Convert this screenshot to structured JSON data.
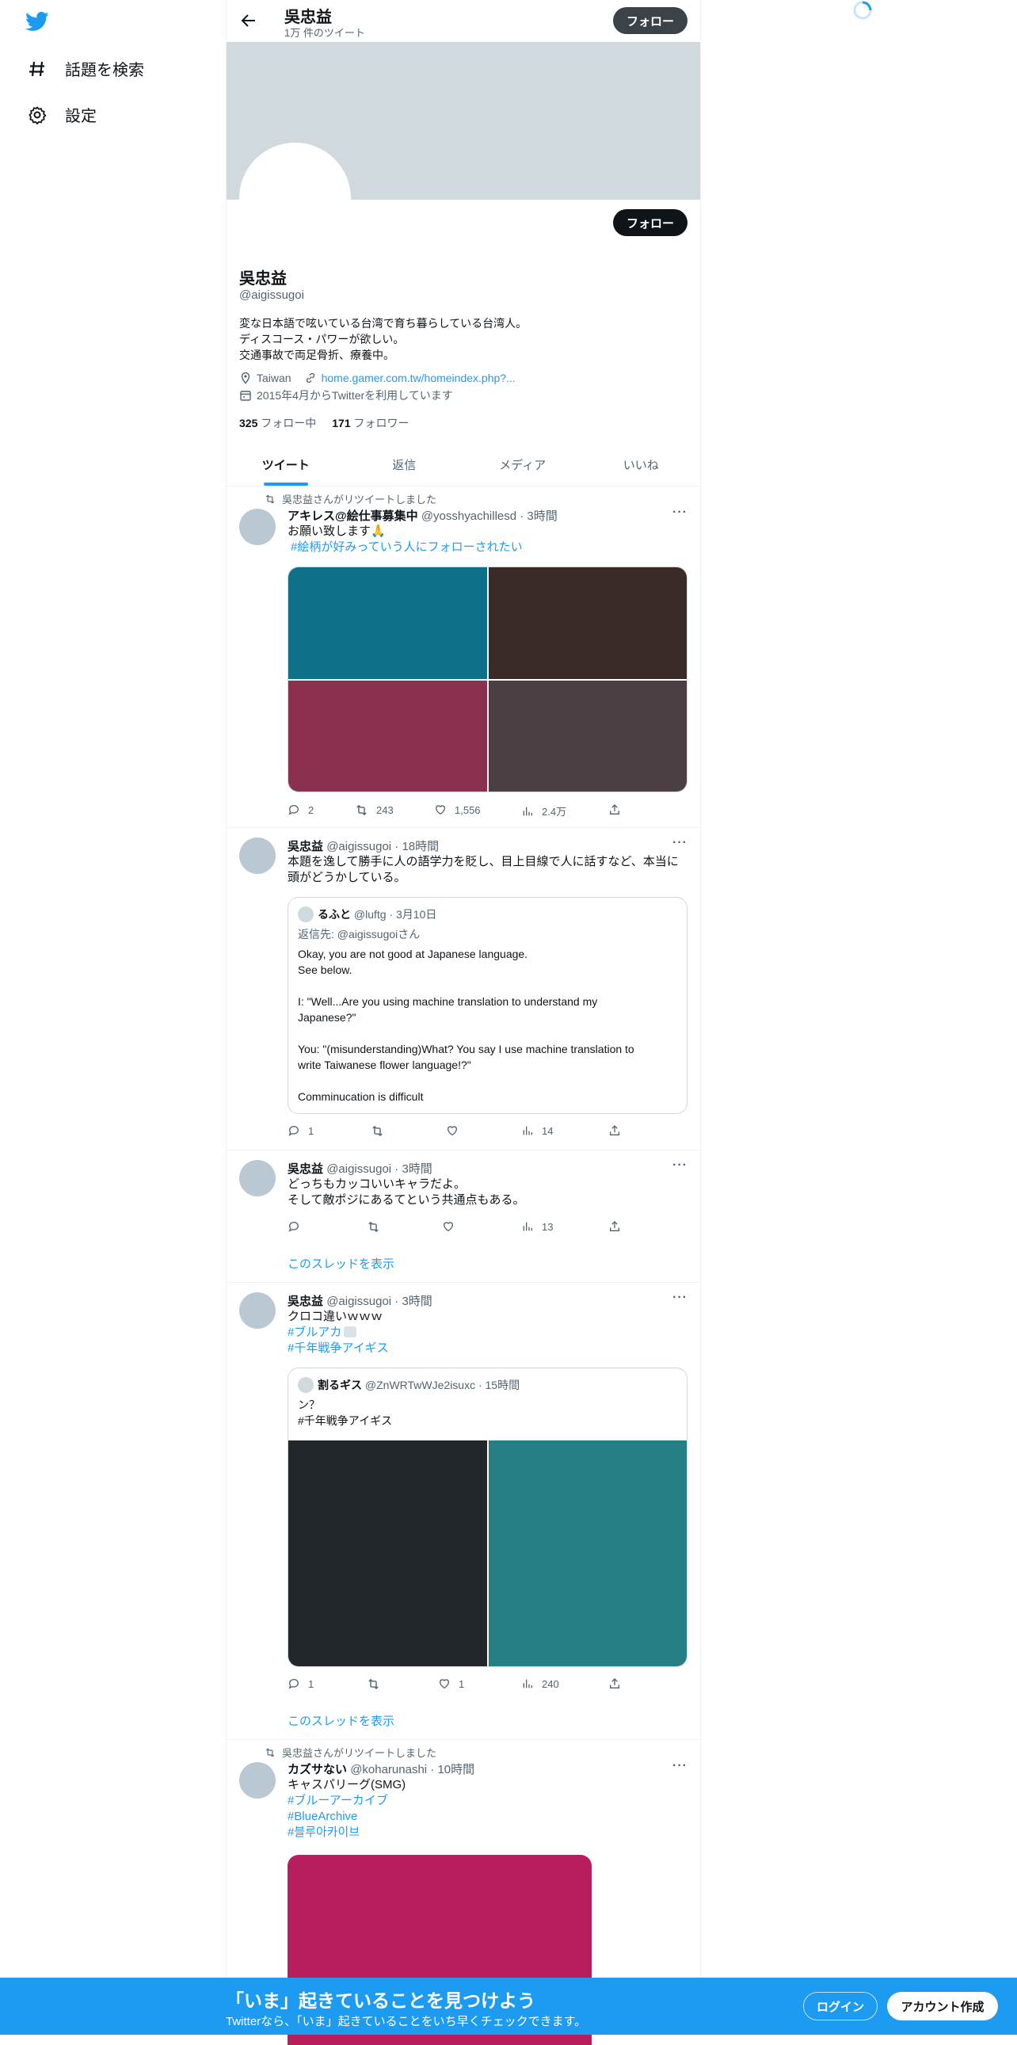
{
  "nav": {
    "items": [
      {
        "label": "話題を検索",
        "icon": "hashtag-icon"
      },
      {
        "label": "設定",
        "icon": "gear-icon"
      }
    ]
  },
  "topbar": {
    "name": "吳忠益",
    "tweet_count": "1万 件のツイート",
    "follow_label": "フォロー"
  },
  "profile": {
    "follow_label": "フォロー",
    "name": "吳忠益",
    "handle": "@aigissugoi",
    "bio": [
      "変な日本語で呟いている台湾で育ち暮らしている台湾人。",
      "ディスコース・パワーが欲しい。",
      "交通事故で両足骨折、療養中。"
    ],
    "location": "Taiwan",
    "url": "home.gamer.com.tw/homeindex.php?...",
    "joined": "2015年4月からTwitterを利用しています",
    "following_count": "325",
    "following_label": "フォロー中",
    "followers_count": "171",
    "followers_label": "フォロワー"
  },
  "tabs": [
    "ツイート",
    "返信",
    "メディア",
    "いいね"
  ],
  "tweets": [
    {
      "retweet_label": "吳忠益さんがリツイートしました",
      "name": "アキレス@絵仕事募集中",
      "meta": "@yosshyachillesd · 3時間",
      "text": "お願い致します🙏",
      "hashtag": "#絵柄が好みっていう人にフォローされたい",
      "image_colors": [
        "#0d6f88",
        "#3a2a28",
        "#8b3150",
        "#4a3f42"
      ],
      "reply": "2",
      "retweet": "243",
      "like": "1,556",
      "views": "2.4万"
    },
    {
      "name": "吳忠益",
      "meta": "@aigissugoi · 18時間",
      "text": [
        "本題を逸して勝手に人の語学力を貶し、目上目線で人に話すなど、本当に",
        "頭がどうかしている。"
      ],
      "quote": {
        "name": "るふと",
        "meta": "@luftg · 3月10日",
        "reply_to_prefix": "返信先: ",
        "reply_to_handle": "@aigissugoi",
        "reply_to_suffix": "さん",
        "lines": [
          "Okay, you are not good at Japanese language.",
          "See below.",
          "",
          "I: \"Well...Are you using machine translation to understand my",
          "Japanese?\"",
          "",
          "You: \"(misunderstanding)What? You say I use machine translation to",
          "write Taiwanese flower language!?\"",
          "",
          "Comminucation is difficult"
        ]
      },
      "reply": "1",
      "retweet": "",
      "like": "",
      "views": "14"
    },
    {
      "name": "吳忠益",
      "meta": "@aigissugoi · 3時間",
      "text": [
        "どっちもカッコいいキャラだよ。",
        "そして敵ポジにあるてという共通点もある。"
      ],
      "reply": "",
      "retweet": "",
      "like": "",
      "views": "13",
      "show_thread": "このスレッドを表示"
    },
    {
      "name": "吳忠益",
      "meta": "@aigissugoi · 3時間",
      "text": "クロコ違いｗｗｗ",
      "hashtags": [
        "#ブルアカ",
        "#千年戦争アイギス"
      ],
      "quote": {
        "name": "割るギス",
        "meta": "@ZnWRTwWJe2isuxc · 15時間",
        "lines": [
          "ン？",
          "#千年戦争アイギス"
        ],
        "image_colors": [
          "#22272b",
          "#267f84"
        ]
      },
      "reply": "1",
      "retweet": "",
      "like": "1",
      "views": "240",
      "show_thread": "このスレッドを表示"
    },
    {
      "retweet_label": "吳忠益さんがリツイートしました",
      "name": "カズサない",
      "meta": "@koharunashi · 10時間",
      "text": "キャスパリーグ(SMG)",
      "hashtags": [
        "#ブルーアーカイブ",
        "#BlueArchive",
        "#블루아카이브"
      ],
      "image_colors": [
        "#b81e5e"
      ]
    }
  ],
  "bottom_bar": {
    "title": "「いま」起きていることを見つけよう",
    "subtitle": "Twitterなら、「いま」起きていることをいち早くチェックできます。",
    "login": "ログイン",
    "signup": "アカウント作成"
  }
}
